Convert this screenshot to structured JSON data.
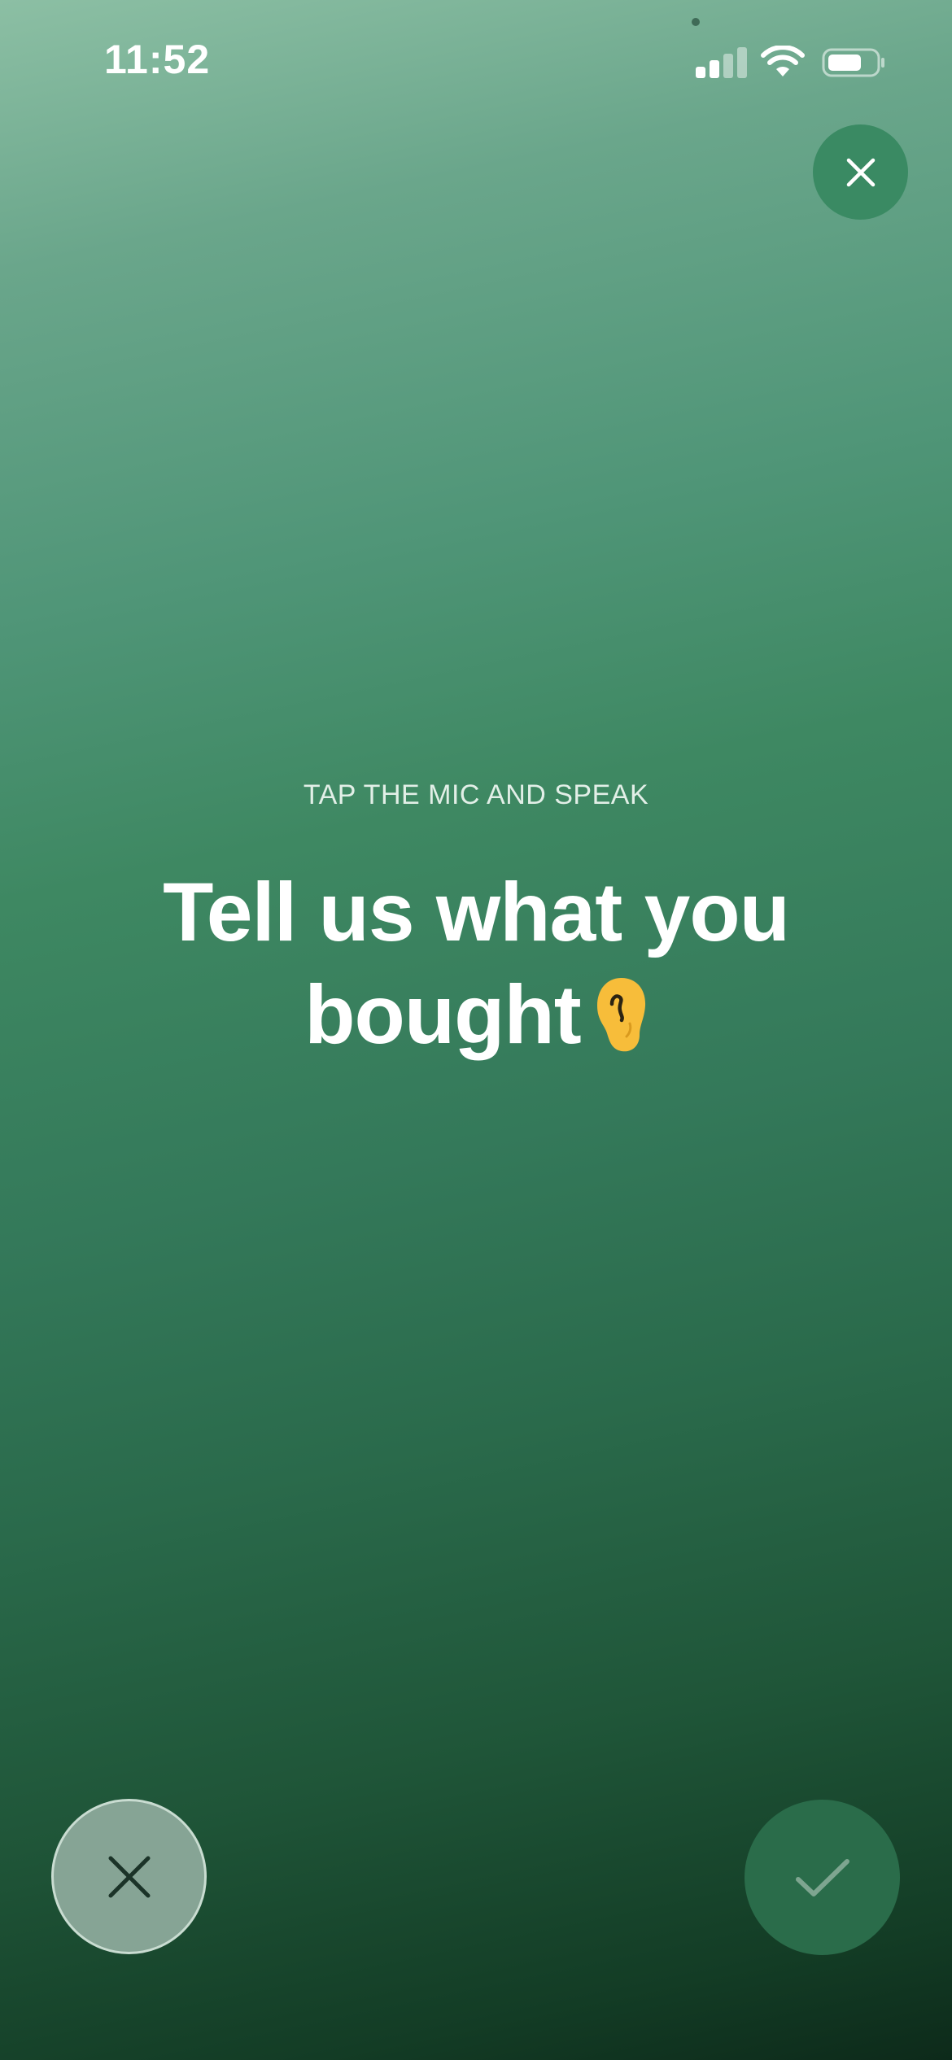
{
  "status_bar": {
    "time": "11:52",
    "icons": [
      "signal-icon",
      "wifi-icon",
      "battery-icon"
    ]
  },
  "prompt": {
    "instruction": "TAP THE MIC AND SPEAK",
    "headline": "Tell us what you bought",
    "headline_emoji": "ear-icon"
  },
  "controls": {
    "top_close_icon": "close-icon",
    "cancel_icon": "close-icon",
    "confirm_icon": "checkmark-icon"
  },
  "colors": {
    "gradient_top": "#8cbfa4",
    "gradient_bottom": "#0d2a1a",
    "emoji_yellow": "#f7bd3a"
  }
}
